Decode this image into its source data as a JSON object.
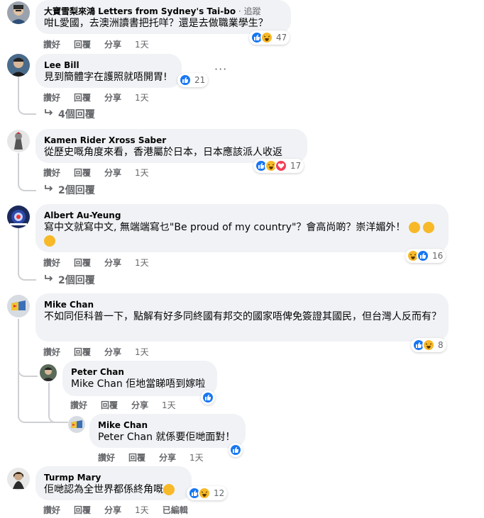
{
  "comments": [
    {
      "author": "大寶雪梨來鴻 Letters from Sydney's Tai-bo",
      "follow_sep": " · ",
      "follow_label": "追蹤",
      "text": "咁L愛國，去澳洲讀書把托咩？還是去做職業學生？",
      "reaction_count": "47",
      "reactions": [
        "like-icon",
        "haha-icon"
      ],
      "actions": {
        "like": "讚好",
        "reply": "回覆",
        "share": "分享",
        "time": "1天"
      }
    },
    {
      "author": "Lee Bill",
      "text": "見到簡體字在護照就唔開胃!",
      "reaction_count": "21",
      "reactions": [
        "like-icon"
      ],
      "actions": {
        "like": "讚好",
        "reply": "回覆",
        "share": "分享",
        "time": "1天"
      },
      "replies_label": "4個回覆",
      "more": "···"
    },
    {
      "author": "Kamen Rider Xross Saber",
      "text": "從歷史嘅角度來看，香港屬於日本，日本應該派人收返",
      "reaction_count": "17",
      "reactions": [
        "like-icon",
        "haha-icon",
        "love-icon"
      ],
      "actions": {
        "like": "讚好",
        "reply": "回覆",
        "share": "分享",
        "time": "1天"
      },
      "replies_label": "2個回覆"
    },
    {
      "author": "Albert Au-Yeung",
      "text": "寫中文就寫中文, 無端端寫乜\"Be proud of my country\"？會高尚啲？崇洋媚外！",
      "reaction_count": "16",
      "reactions": [
        "haha-icon",
        "like-icon"
      ],
      "actions": {
        "like": "讚好",
        "reply": "回覆",
        "share": "分享",
        "time": "1天"
      },
      "replies_label": "2個回覆"
    },
    {
      "author": "Mike Chan",
      "text": "不如同佢科普一下，點解有好多同終國有邦交的國家唔俾免簽證其國民，但台灣人反而有？",
      "reaction_count": "8",
      "reactions": [
        "like-icon",
        "haha-icon"
      ],
      "actions": {
        "like": "讚好",
        "reply": "回覆",
        "share": "分享",
        "time": "1天"
      }
    },
    {
      "author": "Peter Chan",
      "mention": "Mike Chan",
      "text": " 佢地當睇唔到嫁啦",
      "reactions": [
        "like-icon"
      ],
      "actions": {
        "like": "讚好",
        "reply": "回覆",
        "share": "分享",
        "time": "1天"
      }
    },
    {
      "author": "Mike Chan",
      "mention": "Peter Chan",
      "text": " 就係要佢哋面對！",
      "reactions": [
        "like-icon"
      ],
      "actions": {
        "like": "讚好",
        "reply": "回覆",
        "share": "分享",
        "time": "1天"
      }
    },
    {
      "author": "Turmp Mary",
      "text": "佢哋認為全世界都係終角嘅",
      "reaction_count": "12",
      "reactions": [
        "like-icon",
        "haha-icon"
      ],
      "actions": {
        "like": "讚好",
        "reply": "回覆",
        "share": "分享",
        "time": "1天",
        "edited": "已編輯"
      }
    }
  ],
  "colors": {
    "like": "#1877f2",
    "haha": "#f7b928",
    "love": "#f33e58",
    "bubble": "#f0f2f5",
    "meta": "#65676b",
    "link": "#216fdb"
  }
}
